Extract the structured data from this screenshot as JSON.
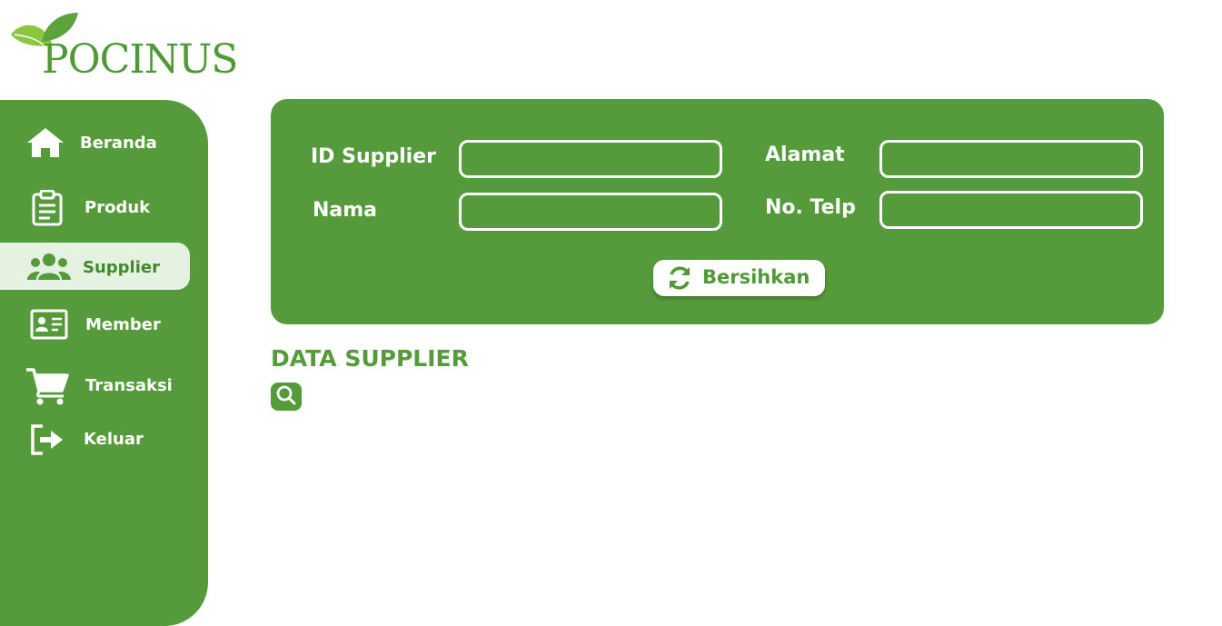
{
  "app": {
    "logo_text": "POCINUS"
  },
  "sidebar": {
    "items": [
      {
        "label": "Beranda",
        "icon": "home-icon"
      },
      {
        "label": "Produk",
        "icon": "clipboard-icon"
      },
      {
        "label": "Supplier",
        "icon": "users-icon",
        "active": true
      },
      {
        "label": "Member",
        "icon": "id-card-icon"
      },
      {
        "label": "Transaksi",
        "icon": "cart-icon"
      },
      {
        "label": "Keluar",
        "icon": "logout-icon"
      }
    ]
  },
  "form": {
    "id_supplier_label": "ID Supplier",
    "nama_label": "Nama",
    "alamat_label": "Alamat",
    "telp_label": "No. Telp",
    "id_supplier_value": "",
    "nama_value": "",
    "alamat_value": "",
    "telp_value": "",
    "clear_label": "Bersihkan"
  },
  "section": {
    "title": "DATA SUPPLIER"
  },
  "colors": {
    "primary": "#559b3b",
    "active_bg": "#e6f2e1",
    "logo": "#4f9a36"
  }
}
